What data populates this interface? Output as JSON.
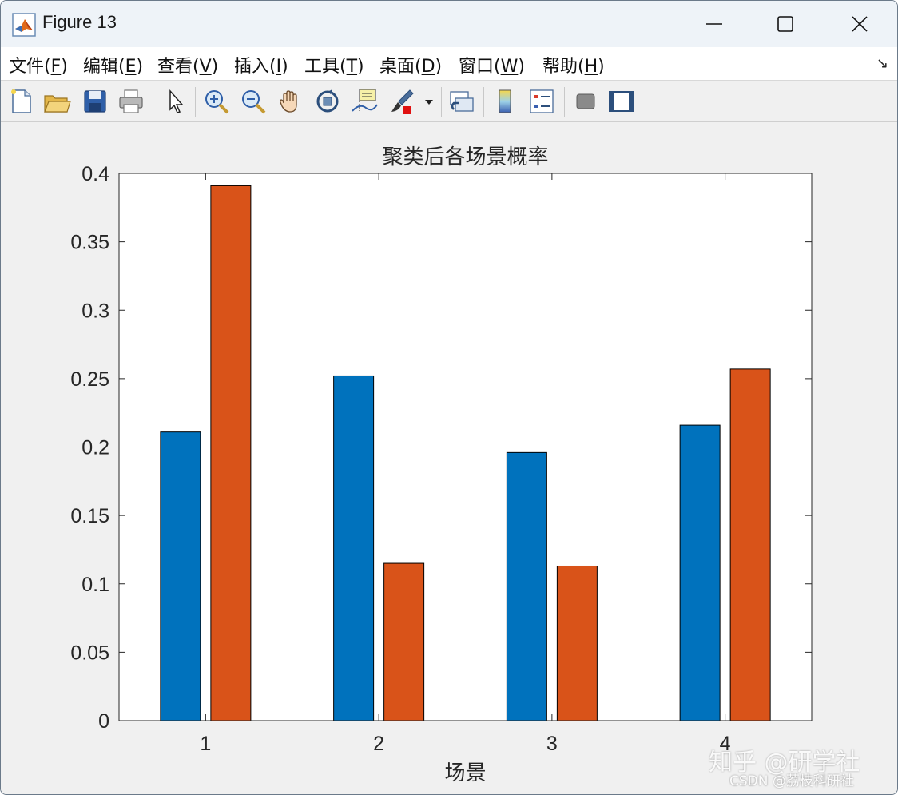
{
  "window": {
    "title": "Figure 13"
  },
  "menu": {
    "items": [
      {
        "label": "文件(",
        "mnemonic": "F",
        "close": ")"
      },
      {
        "label": "编辑(",
        "mnemonic": "E",
        "close": ")"
      },
      {
        "label": "查看(",
        "mnemonic": "V",
        "close": ")"
      },
      {
        "label": "插入(",
        "mnemonic": "I",
        "close": ")"
      },
      {
        "label": "工具(",
        "mnemonic": "T",
        "close": ")"
      },
      {
        "label": "桌面(",
        "mnemonic": "D",
        "close": ")"
      },
      {
        "label": "窗口(",
        "mnemonic": "W",
        "close": ")"
      },
      {
        "label": "帮助(",
        "mnemonic": "H",
        "close": ")"
      }
    ]
  },
  "toolbar": {
    "icons": [
      "new-figure-icon",
      "open-file-icon",
      "save-icon",
      "print-icon",
      "pointer-icon",
      "zoom-in-icon",
      "zoom-out-icon",
      "pan-icon",
      "rotate-3d-icon",
      "data-cursor-icon",
      "brush-icon",
      "link-plot-icon",
      "colorbar-icon",
      "legend-icon",
      "hide-plot-tools-icon",
      "show-plot-tools-icon"
    ]
  },
  "chart_data": {
    "type": "bar",
    "title": "聚类后各场景概率",
    "xlabel": "场景",
    "ylabel": "",
    "categories": [
      "1",
      "2",
      "3",
      "4"
    ],
    "series": [
      {
        "values": [
          0.211,
          0.252,
          0.196,
          0.216
        ],
        "color": "#0072BD"
      },
      {
        "values": [
          0.391,
          0.115,
          0.113,
          0.257
        ],
        "color": "#D95319"
      }
    ],
    "ylim": [
      0,
      0.4
    ],
    "yticks": [
      "0",
      "0.05",
      "0.1",
      "0.15",
      "0.2",
      "0.25",
      "0.3",
      "0.35",
      "0.4"
    ],
    "grid": false
  },
  "watermark": {
    "line1": "知乎 @研学社",
    "line2": "CSDN @荔枝科研社"
  }
}
